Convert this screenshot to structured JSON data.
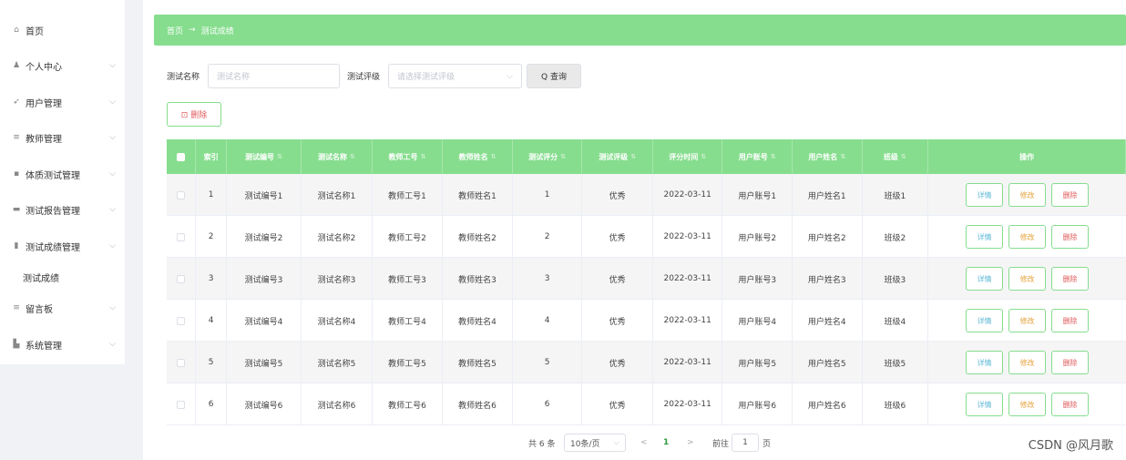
{
  "sidebar": {
    "items": [
      {
        "label": "首页",
        "icon": "home-icon",
        "glyph": "⌂",
        "chevron": false
      },
      {
        "label": "个人中心",
        "icon": "user-icon",
        "glyph": "♟",
        "chevron": true
      },
      {
        "label": "用户管理",
        "icon": "send-icon",
        "glyph": "➶",
        "chevron": true
      },
      {
        "label": "教师管理",
        "icon": "menu-icon",
        "glyph": "≡",
        "chevron": true
      },
      {
        "label": "体质测试管理",
        "icon": "grid-icon",
        "glyph": "▪",
        "chevron": true
      },
      {
        "label": "测试报告管理",
        "icon": "card-icon",
        "glyph": "▬",
        "chevron": true
      },
      {
        "label": "测试成绩管理",
        "icon": "trash-icon",
        "glyph": "▮",
        "chevron": true
      },
      {
        "label": "留言板",
        "icon": "menu-icon",
        "glyph": "≡",
        "chevron": true
      },
      {
        "label": "系统管理",
        "icon": "chart-icon",
        "glyph": "▙",
        "chevron": true
      }
    ],
    "submenu_label": "测试成绩"
  },
  "breadcrumb": {
    "home": "首页",
    "arrow": "→",
    "current": "测试成绩"
  },
  "search": {
    "name_label": "测试名称",
    "name_placeholder": "测试名称",
    "grade_label": "测试评级",
    "grade_placeholder": "请选择测试评级",
    "query_label": "Q 查询"
  },
  "delete_label": "⊡ 删除",
  "table": {
    "headers": [
      "索引",
      "测试编号",
      "测试名称",
      "教师工号",
      "教师姓名",
      "测试评分",
      "测试评级",
      "评分时间",
      "用户账号",
      "用户姓名",
      "班级",
      "操作"
    ],
    "sortable": [
      false,
      true,
      true,
      true,
      true,
      true,
      true,
      true,
      true,
      true,
      true,
      false
    ],
    "rows": [
      [
        "1",
        "测试编号1",
        "测试名称1",
        "教师工号1",
        "教师姓名1",
        "1",
        "优秀",
        "2022-03-11",
        "用户账号1",
        "用户姓名1",
        "班级1"
      ],
      [
        "2",
        "测试编号2",
        "测试名称2",
        "教师工号2",
        "教师姓名2",
        "2",
        "优秀",
        "2022-03-11",
        "用户账号2",
        "用户姓名2",
        "班级2"
      ],
      [
        "3",
        "测试编号3",
        "测试名称3",
        "教师工号3",
        "教师姓名3",
        "3",
        "优秀",
        "2022-03-11",
        "用户账号3",
        "用户姓名3",
        "班级3"
      ],
      [
        "4",
        "测试编号4",
        "测试名称4",
        "教师工号4",
        "教师姓名4",
        "4",
        "优秀",
        "2022-03-11",
        "用户账号4",
        "用户姓名4",
        "班级4"
      ],
      [
        "5",
        "测试编号5",
        "测试名称5",
        "教师工号5",
        "教师姓名5",
        "5",
        "优秀",
        "2022-03-11",
        "用户账号5",
        "用户姓名5",
        "班级5"
      ],
      [
        "6",
        "测试编号6",
        "测试名称6",
        "教师工号6",
        "教师姓名6",
        "6",
        "优秀",
        "2022-03-11",
        "用户账号6",
        "用户姓名6",
        "班级6"
      ]
    ],
    "actions": {
      "detail": "详情",
      "edit": "修改",
      "delete": "删除"
    }
  },
  "pagination": {
    "total": "共 6 条",
    "page_size": "10条/页",
    "prev": "<",
    "current": "1",
    "next": ">",
    "goto_label": "前往",
    "goto_value": "1",
    "page_suffix": "页"
  },
  "watermark": "CSDN @风月歌",
  "colors": {
    "accent": "#86dd8e",
    "danger": "#e05a5a",
    "warning": "#e6a23c",
    "info": "#5cb8d6"
  }
}
